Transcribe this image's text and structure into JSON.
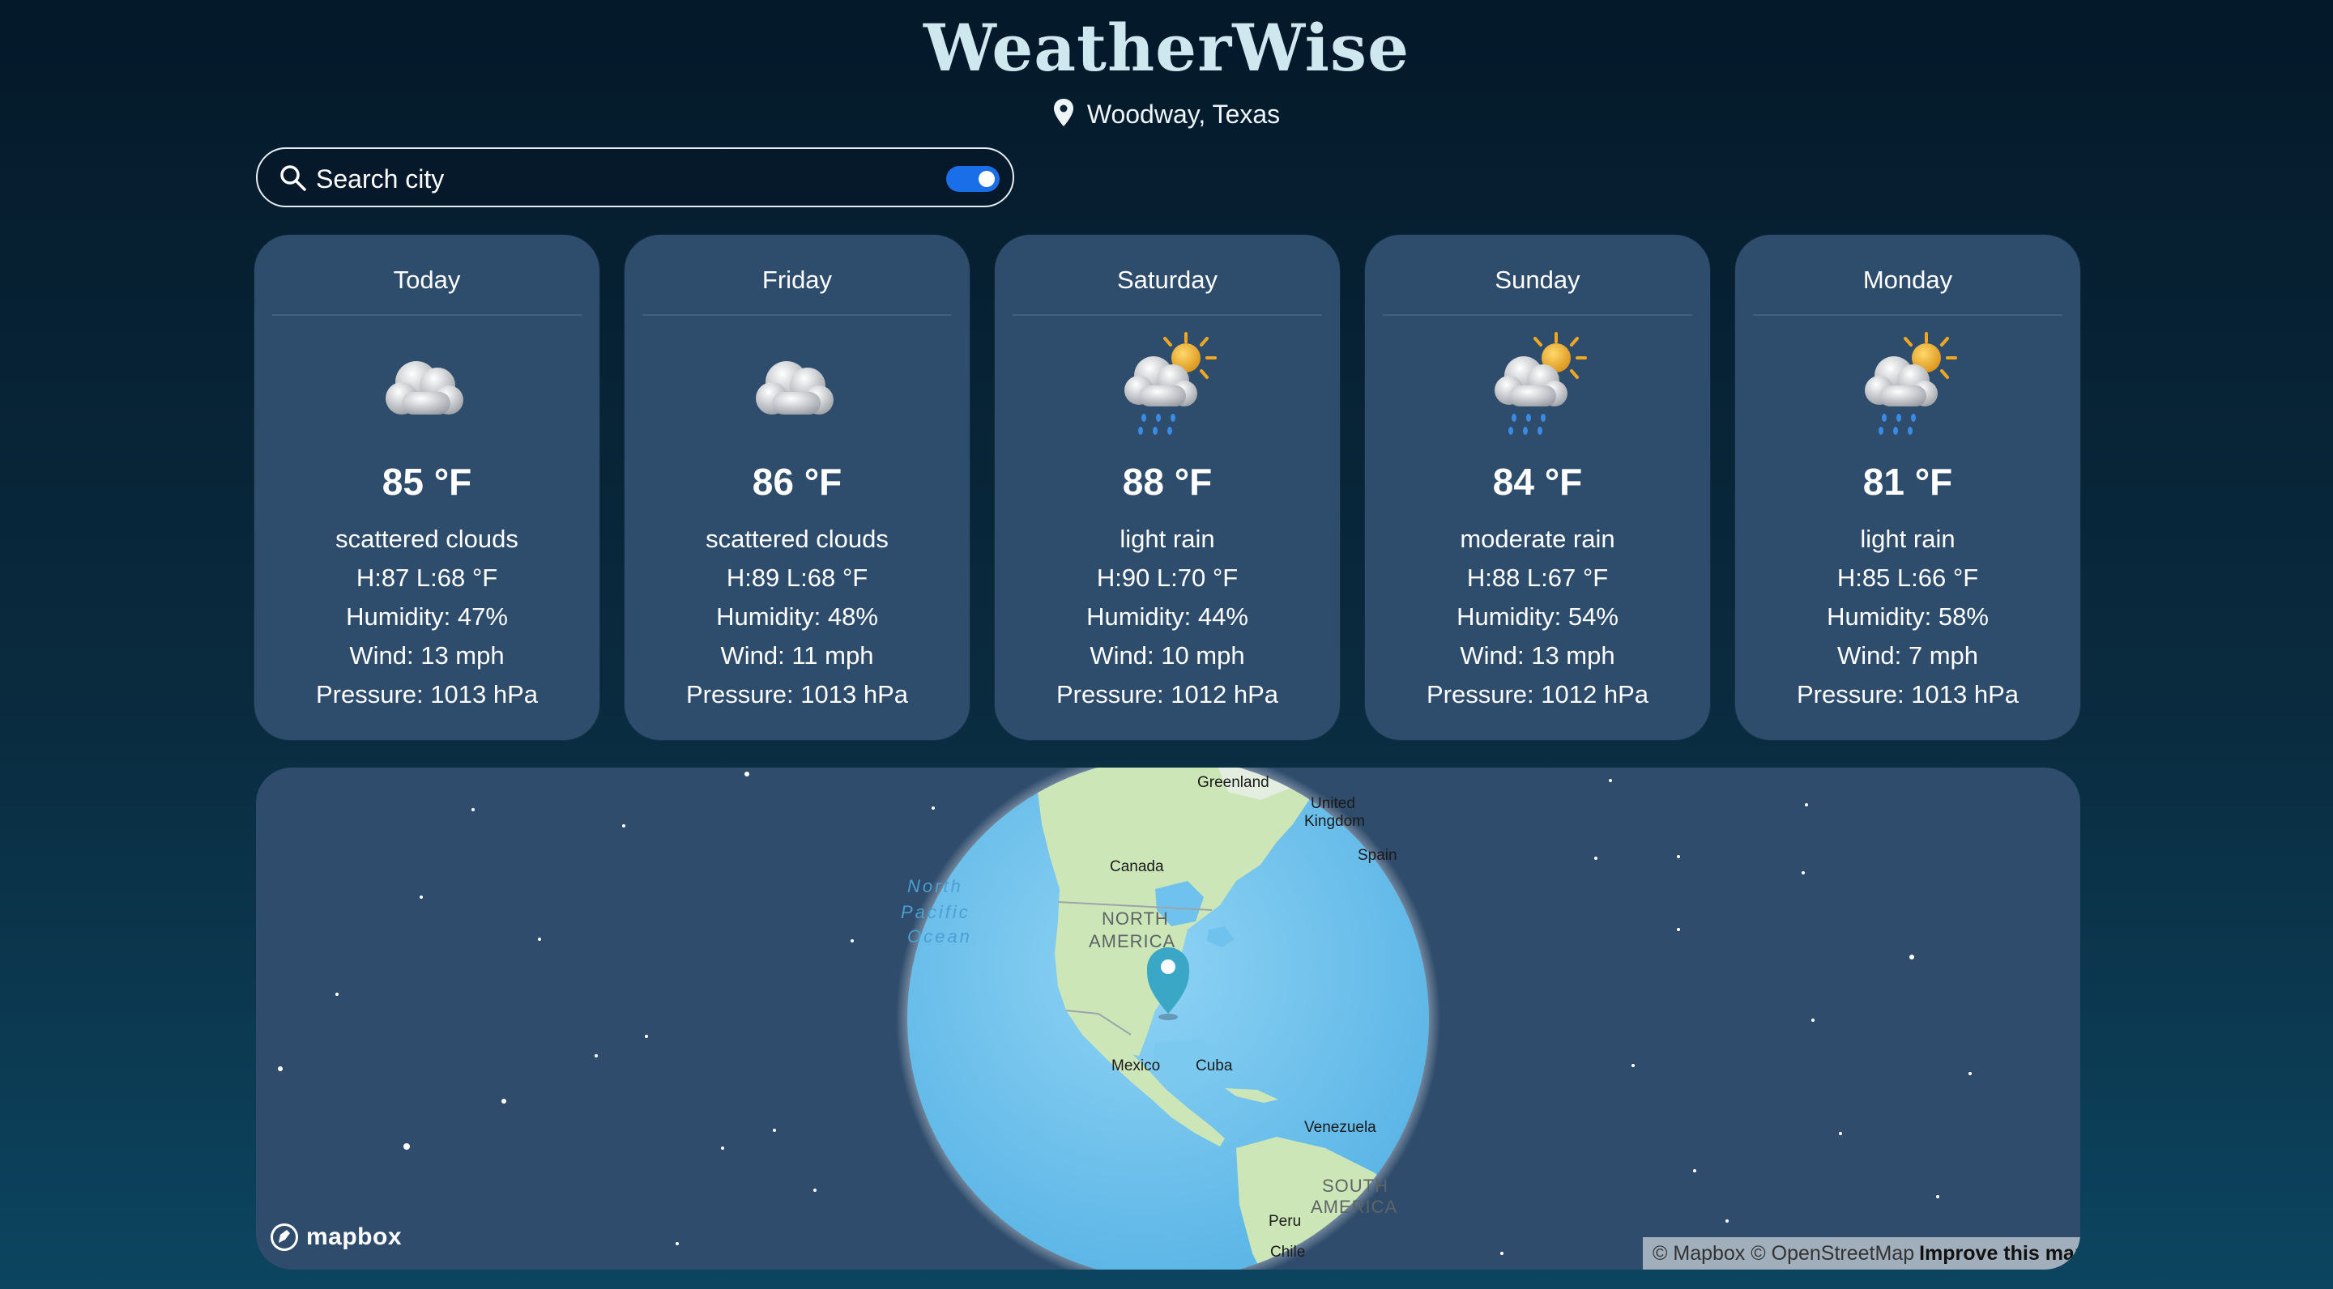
{
  "app": {
    "title": "WeatherWise",
    "location": "Woodway, Texas"
  },
  "search": {
    "placeholder": "Search city",
    "toggle_on": true,
    "toggle_color": "#1a6ee8"
  },
  "forecast": [
    {
      "day": "Today",
      "icon": "cloud-icon",
      "temp": "85 °F",
      "condition": "scattered clouds",
      "hilo": "H:87 L:68 °F",
      "humidity": "Humidity: 47%",
      "wind": "Wind: 13 mph",
      "pressure": "Pressure: 1013 hPa"
    },
    {
      "day": "Friday",
      "icon": "cloud-icon",
      "temp": "86 °F",
      "condition": "scattered clouds",
      "hilo": "H:89 L:68 °F",
      "humidity": "Humidity: 48%",
      "wind": "Wind: 11 mph",
      "pressure": "Pressure: 1013 hPa"
    },
    {
      "day": "Saturday",
      "icon": "sun-rain-icon",
      "temp": "88 °F",
      "condition": "light rain",
      "hilo": "H:90 L:70 °F",
      "humidity": "Humidity: 44%",
      "wind": "Wind: 10 mph",
      "pressure": "Pressure: 1012 hPa"
    },
    {
      "day": "Sunday",
      "icon": "sun-rain-icon",
      "temp": "84 °F",
      "condition": "moderate rain",
      "hilo": "H:88 L:67 °F",
      "humidity": "Humidity: 54%",
      "wind": "Wind: 13 mph",
      "pressure": "Pressure: 1012 hPa"
    },
    {
      "day": "Monday",
      "icon": "sun-rain-icon",
      "temp": "81 °F",
      "condition": "light rain",
      "hilo": "H:85 L:66 °F",
      "humidity": "Humidity: 58%",
      "wind": "Wind: 7 mph",
      "pressure": "Pressure: 1013 hPa"
    }
  ],
  "map": {
    "labels": {
      "greenland": "Greenland",
      "uk_1": "United",
      "uk_2": "Kingdom",
      "spain": "Spain",
      "canada": "Canada",
      "ocean_1": "North",
      "ocean_2": "Pacific",
      "ocean_3": "Ocean",
      "na_1": "NORTH",
      "na_2": "AMERICA",
      "mexico": "Mexico",
      "cuba": "Cuba",
      "venezuela": "Venezuela",
      "sa_1": "SOUTH",
      "sa_2": "AMERICA",
      "peru": "Peru",
      "chile": "Chile"
    },
    "logo": "mapbox",
    "attribution": "© Mapbox © OpenStreetMap",
    "improve_link": "Improve this map",
    "marker_color": "#3aa7c6"
  },
  "colors": {
    "card_bg": "#2e4c6c",
    "title": "#cfe7ef",
    "ocean": "#7cc9f0",
    "land": "#cde6b8"
  }
}
